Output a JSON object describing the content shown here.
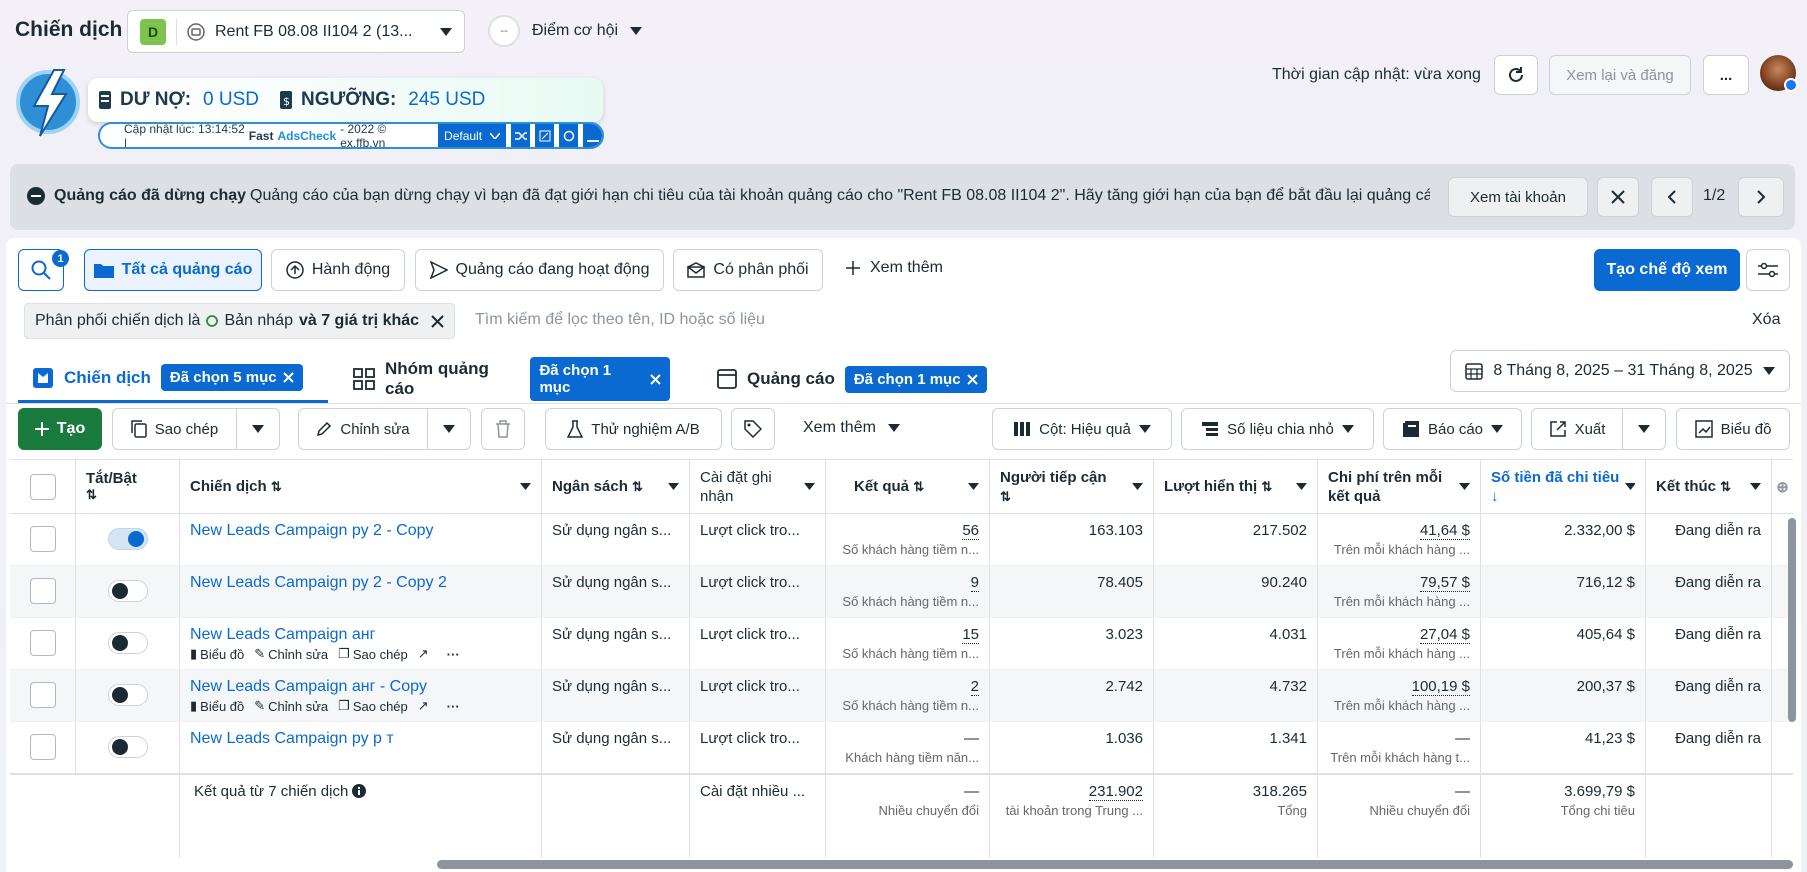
{
  "header": {
    "title": "Chiến dịch",
    "account_badge": "D",
    "account_name": "Rent FB 08.08 II104 2 (13...",
    "opportunity_label": "Điểm cơ hội",
    "opportunity_badge": "--",
    "update_time": "Thời gian cập nhật: vừa xong",
    "review_publish": "Xem lại và đăng",
    "more": "..."
  },
  "extension": {
    "debt_label": "DƯ NỢ:",
    "debt_value": "0 USD",
    "threshold_label": "NGƯỠNG:",
    "threshold_value": "245 USD",
    "updated_prefix": "Cập nhật lúc: 13:14:52 |",
    "brand_a": "Fast",
    "brand_b": "AdsCheck",
    "suffix": "- 2022 © ex.ffb.vn",
    "preset": "Default"
  },
  "alert": {
    "title": "Quảng cáo đã dừng chạy",
    "message": "Quảng cáo của bạn dừng chạy vì bạn đã đạt giới hạn chi tiêu của tài khoản quảng cáo cho \"Rent FB 08.08 II104 2\". Hãy tăng giới hạn của bạn để bắt đầu lại quảng cá...",
    "view_account": "Xem tài khoản",
    "pager": "1/2"
  },
  "filters": {
    "search_badge": "1",
    "all_ads": "Tất cả quảng cáo",
    "actions": "Hành động",
    "active_ads": "Quảng cáo đang hoạt động",
    "delivering": "Có phân phối",
    "see_more": "Xem thêm",
    "create_view": "Tạo chế độ xem"
  },
  "filter_bar": {
    "chip_prefix": "Phân phối chiến dịch là",
    "chip_value": "Bản nháp",
    "chip_suffix": "và 7 giá trị khác",
    "placeholder": "Tìm kiếm để lọc theo tên, ID hoặc số liệu",
    "clear": "Xóa"
  },
  "levels": {
    "campaigns": "Chiến dịch",
    "campaigns_sel": "Đã chọn 5 mục",
    "adsets": "Nhóm quảng cáo",
    "adsets_sel": "Đã chọn 1 mục",
    "ads": "Quảng cáo",
    "ads_sel": "Đã chọn 1 mục",
    "date_range": "8 Tháng 8, 2025 – 31 Tháng 8, 2025"
  },
  "toolbar": {
    "create": "Tạo",
    "copy": "Sao chép",
    "edit": "Chỉnh sửa",
    "ab_test": "Thử nghiệm A/B",
    "see_more": "Xem thêm",
    "columns": "Cột: Hiệu quả",
    "breakdown": "Số liệu chia nhỏ",
    "reports": "Báo cáo",
    "export": "Xuất",
    "charts": "Biểu đồ"
  },
  "columns": {
    "toggle": "Tắt/Bật",
    "campaign": "Chiến dịch",
    "budget": "Ngân sách",
    "attribution": "Cài đặt ghi nhận",
    "results": "Kết quả",
    "reach": "Người tiếp cận",
    "impressions": "Lượt hiển thị",
    "cost_per_result": "Chi phí trên mỗi kết quả",
    "amount_spent": "Số tiền đã chi tiêu",
    "ends": "Kết thúc"
  },
  "row_actions": {
    "chart": "Biểu đồ",
    "edit": "Chỉnh sửa",
    "copy": "Sao chép"
  },
  "rows": [
    {
      "name": "New Leads Campaign ру 2 - Copy",
      "budget": "Sử dụng ngân s...",
      "attribution": "Lượt click tro...",
      "result": "56",
      "result_sub": "Số khách hàng tiềm n...",
      "reach": "163.103",
      "impressions": "217.502",
      "cpr": "41,64 $",
      "cpr_sub": "Trên mỗi khách hàng ...",
      "spent": "2.332,00 $",
      "ends": "Đang diễn ra"
    },
    {
      "name": "New Leads Campaign ру 2 - Copy 2",
      "budget": "Sử dụng ngân s...",
      "attribution": "Lượt click tro...",
      "result": "9",
      "result_sub": "Số khách hàng tiềm n...",
      "reach": "78.405",
      "impressions": "90.240",
      "cpr": "79,57 $",
      "cpr_sub": "Trên mỗi khách hàng ...",
      "spent": "716,12 $",
      "ends": "Đang diễn ra"
    },
    {
      "name": "New Leads Campaign анг",
      "budget": "Sử dụng ngân s...",
      "attribution": "Lượt click tro...",
      "result": "15",
      "result_sub": "Số khách hàng tiềm n...",
      "reach": "3.023",
      "impressions": "4.031",
      "cpr": "27,04 $",
      "cpr_sub": "Trên mỗi khách hàng ...",
      "spent": "405,64 $",
      "ends": "Đang diễn ra"
    },
    {
      "name": "New Leads Campaign анг - Copy",
      "budget": "Sử dụng ngân s...",
      "attribution": "Lượt click tro...",
      "result": "2",
      "result_sub": "Số khách hàng tiềm n...",
      "reach": "2.742",
      "impressions": "4.732",
      "cpr": "100,19 $",
      "cpr_sub": "Trên mỗi khách hàng ...",
      "spent": "200,37 $",
      "ends": "Đang diễn ra"
    },
    {
      "name": "New Leads Campaign ру р т",
      "budget": "Sử dụng ngân s...",
      "attribution": "Lượt click tro...",
      "result": "—",
      "result_sub": "Khách hàng tiềm năn...",
      "reach": "1.036",
      "impressions": "1.341",
      "cpr": "—",
      "cpr_sub": "Trên mỗi khách hàng t...",
      "spent": "41,23 $",
      "ends": "Đang diễn ra"
    }
  ],
  "totals": {
    "label": "Kết quả từ 7 chiến dịch",
    "attribution": "Cài đặt nhiều ...",
    "result": "—",
    "result_sub": "Nhiều chuyển đổi",
    "reach": "231.902",
    "reach_sub": "tài khoản trong Trung ...",
    "impressions": "318.265",
    "impressions_sub": "Tổng",
    "cpr": "—",
    "cpr_sub": "Nhiều chuyển đổi",
    "spent": "3.699,79 $",
    "spent_sub": "Tổng chi tiêu"
  }
}
